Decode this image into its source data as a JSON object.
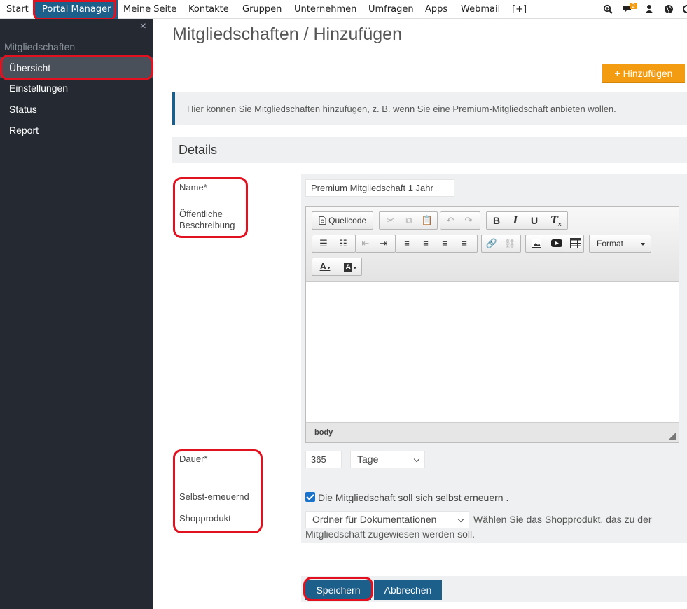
{
  "topnav": {
    "items": [
      "Start",
      "Portal Manager",
      "Meine Seite",
      "Kontakte",
      "Gruppen",
      "Unternehmen",
      "Umfragen",
      "Apps",
      "Webmail",
      "[+]"
    ],
    "active": "Portal Manager",
    "notification_count": "2",
    "icons": [
      "search-plus-icon",
      "chat-icon",
      "user-icon",
      "globe-icon",
      "settings-icon"
    ]
  },
  "sidebar": {
    "close": "×",
    "heading": "Mitgliedschaften",
    "items": [
      "Übersicht",
      "Einstellungen",
      "Status",
      "Report"
    ],
    "active": "Übersicht"
  },
  "main": {
    "title": "Mitgliedschaften / Hinzufügen",
    "add_button": "Hinzufügen",
    "info_text": "Hier können Sie Mitgliedschaften hinzufügen, z. B. wenn Sie eine Premium-Mitgliedschaft anbieten wollen.",
    "details_heading": "Details"
  },
  "form": {
    "name_label": "Name*",
    "name_value": "Premium Mitgliedschaft 1 Jahr",
    "description_label_line1": "Öffentliche",
    "description_label_line2": "Beschreibung",
    "editor": {
      "source_button": "Quellcode",
      "format_dropdown": "Format",
      "status_path": "body"
    },
    "duration_label": "Dauer*",
    "duration_value": "365",
    "duration_unit": "Tage",
    "renew_label": "Selbst-erneuernd",
    "renew_checked": true,
    "renew_text": "Die Mitgliedschaft soll sich selbst erneuern .",
    "shop_label": "Shopprodukt",
    "shop_select_value": "Ordner für Dokumentationen",
    "shop_help": "Wählen Sie das Shopprodukt, das zu der Mitgliedschaft zugewiesen werden soll."
  },
  "actions": {
    "save": "Speichern",
    "cancel": "Abbrechen"
  },
  "colors": {
    "primary": "#1d5f8b",
    "accent": "#f39c12",
    "sidebar_bg": "#252a32",
    "annotation": "#e2111f"
  }
}
